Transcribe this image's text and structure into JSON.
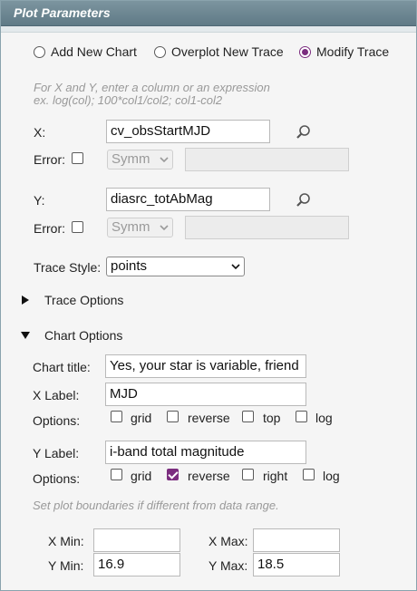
{
  "title": "Plot Parameters",
  "modes": [
    {
      "label": "Add New Chart",
      "checked": false
    },
    {
      "label": "Overplot New Trace",
      "checked": false
    },
    {
      "label": "Modify Trace",
      "checked": true
    }
  ],
  "hint": {
    "line1": "For X and Y, enter a column or an expression",
    "line2": "ex. log(col); 100*col1/col2; col1-col2"
  },
  "x": {
    "label": "X:",
    "value": "cv_obsStartMJD",
    "error_label": "Error:",
    "error_type": "Symm"
  },
  "y": {
    "label": "Y:",
    "value": "diasrc_totAbMag",
    "error_label": "Error:",
    "error_type": "Symm"
  },
  "trace_style": {
    "label": "Trace Style:",
    "value": "points"
  },
  "sections": {
    "trace_options": "Trace Options",
    "chart_options": "Chart Options"
  },
  "chart": {
    "title_label": "Chart title:",
    "title_value": "Yes, your star is variable, friend",
    "xlabel_label": "X Label:",
    "xlabel_value": "MJD",
    "ylabel_label": "Y Label:",
    "ylabel_value": "i-band total magnitude",
    "options_label": "Options:",
    "x_options": [
      {
        "label": "grid",
        "checked": false
      },
      {
        "label": "reverse",
        "checked": false
      },
      {
        "label": "top",
        "checked": false
      },
      {
        "label": "log",
        "checked": false
      }
    ],
    "y_options": [
      {
        "label": "grid",
        "checked": false
      },
      {
        "label": "reverse",
        "checked": true
      },
      {
        "label": "right",
        "checked": false
      },
      {
        "label": "log",
        "checked": false
      }
    ]
  },
  "boundaries": {
    "hint": "Set plot boundaries if different from data range.",
    "xmin_label": "X Min:",
    "xmin_value": "",
    "xmax_label": "X Max:",
    "xmax_value": "",
    "ymin_label": "Y Min:",
    "ymin_value": "16.9",
    "ymax_label": "Y Max:",
    "ymax_value": "18.5"
  },
  "colors": {
    "accent": "#7b2d7f",
    "title_bar": "#6b8591"
  }
}
